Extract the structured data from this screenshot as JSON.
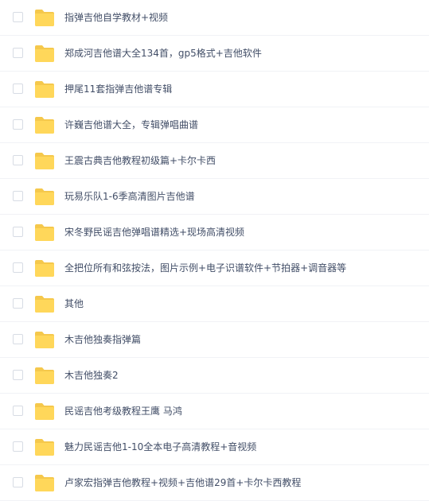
{
  "files": [
    {
      "name": "指弹吉他自学教材+视频",
      "icon": "folder-icon"
    },
    {
      "name": "郑成河吉他谱大全134首，gp5格式+吉他软件",
      "icon": "folder-icon"
    },
    {
      "name": "押尾11套指弹吉他谱专辑",
      "icon": "folder-icon"
    },
    {
      "name": "许巍吉他谱大全，专辑弹唱曲谱",
      "icon": "folder-icon"
    },
    {
      "name": "王震古典吉他教程初级篇+卡尔卡西",
      "icon": "folder-icon"
    },
    {
      "name": "玩易乐队1-6季高清图片吉他谱",
      "icon": "folder-icon"
    },
    {
      "name": "宋冬野民谣吉他弹唱谱精选+现场高清视频",
      "icon": "folder-icon"
    },
    {
      "name": "全把位所有和弦按法，图片示例+电子识谱软件+节拍器+调音器等",
      "icon": "folder-icon"
    },
    {
      "name": "其他",
      "icon": "folder-icon"
    },
    {
      "name": "木吉他独奏指弹篇",
      "icon": "folder-icon"
    },
    {
      "name": "木吉他独奏2",
      "icon": "folder-icon"
    },
    {
      "name": "民谣吉他考级教程王鹰 马鸿",
      "icon": "folder-icon"
    },
    {
      "name": "魅力民谣吉他1-10全本电子高清教程+音视频",
      "icon": "folder-icon"
    },
    {
      "name": "卢家宏指弹吉他教程+视频+吉他谱29首+卡尔卡西教程",
      "icon": "folder-icon"
    }
  ],
  "colors": {
    "text": "#424e67",
    "folder_back": "#f5c84c",
    "folder_front": "#ffd75a",
    "checkbox_border": "#d7dce4",
    "divider": "#f1f2f6"
  }
}
